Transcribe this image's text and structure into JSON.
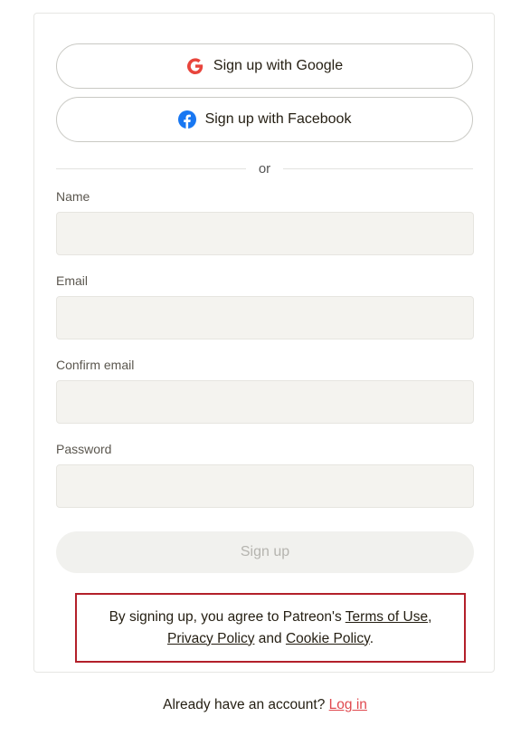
{
  "oauth": {
    "google_label": "Sign up with Google",
    "facebook_label": "Sign up with Facebook",
    "google_icon": "google-g-icon",
    "facebook_icon": "facebook-f-icon"
  },
  "divider": {
    "text": "or"
  },
  "form": {
    "name_label": "Name",
    "name_value": "",
    "email_label": "Email",
    "email_value": "",
    "confirm_email_label": "Confirm email",
    "confirm_email_value": "",
    "password_label": "Password",
    "password_value": "",
    "submit_label": "Sign up"
  },
  "terms": {
    "prefix": "By signing up, you agree to Patreon's ",
    "terms_link": "Terms of Use",
    "comma": ",",
    "privacy_link": "Privacy Policy",
    "and": " and ",
    "cookie_link": "Cookie Policy",
    "period": "."
  },
  "footer": {
    "prompt": "Already have an account? ",
    "login_link": "Log in"
  },
  "colors": {
    "google_red": "#ea4335",
    "facebook_blue": "#1877f2",
    "link_red": "#e0494f",
    "highlight_border": "#b3202a"
  }
}
